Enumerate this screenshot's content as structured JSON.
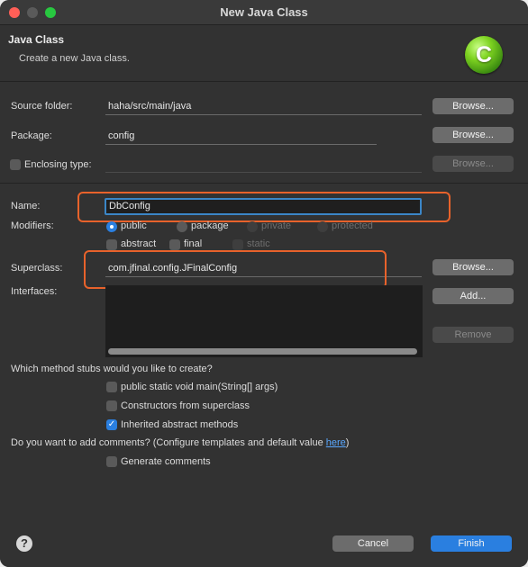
{
  "window": {
    "title": "New Java Class"
  },
  "header": {
    "title": "Java Class",
    "description": "Create a new Java class.",
    "logo_letter": "C"
  },
  "source_folder": {
    "label": "Source folder:",
    "value": "haha/src/main/java",
    "browse": "Browse..."
  },
  "package": {
    "label": "Package:",
    "value": "config",
    "browse": "Browse..."
  },
  "enclosing": {
    "label": "Enclosing type:",
    "value": "",
    "browse": "Browse..."
  },
  "name": {
    "label": "Name:",
    "value": "DbConfig"
  },
  "modifiers": {
    "label": "Modifiers:",
    "access": [
      {
        "label": "public",
        "selected": true,
        "enabled": true
      },
      {
        "label": "package",
        "selected": false,
        "enabled": true
      },
      {
        "label": "private",
        "selected": false,
        "enabled": false
      },
      {
        "label": "protected",
        "selected": false,
        "enabled": false
      }
    ],
    "flags": [
      {
        "label": "abstract",
        "checked": false,
        "enabled": true
      },
      {
        "label": "final",
        "checked": false,
        "enabled": true
      },
      {
        "label": "static",
        "checked": false,
        "enabled": false
      }
    ]
  },
  "superclass": {
    "label": "Superclass:",
    "value": "com.jfinal.config.JFinalConfig",
    "browse": "Browse..."
  },
  "interfaces": {
    "label": "Interfaces:",
    "add": "Add...",
    "remove": "Remove"
  },
  "stubs": {
    "question": "Which method stubs would you like to create?",
    "options": [
      {
        "label": "public static void main(String[] args)",
        "checked": false
      },
      {
        "label": "Constructors from superclass",
        "checked": false
      },
      {
        "label": "Inherited abstract methods",
        "checked": true
      }
    ]
  },
  "comments": {
    "question_prefix": "Do you want to add comments? (Configure templates and default value ",
    "link": "here",
    "question_suffix": ")",
    "option": "Generate comments",
    "checked": false
  },
  "footer": {
    "help": "?",
    "cancel": "Cancel",
    "finish": "Finish"
  },
  "colors": {
    "highlight": "#e8622b",
    "accent": "#2a7fe0"
  }
}
